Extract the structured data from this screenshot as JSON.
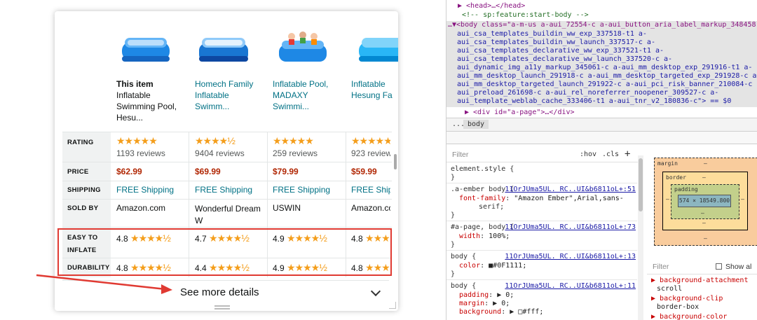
{
  "products": [
    {
      "title_lines": [
        "This item",
        "Inflatable",
        "Swimming Pool,",
        "Hesu..."
      ],
      "is_this_item": true,
      "rating_stars": "★★★★★",
      "reviews": "1193 reviews",
      "price": "$62.99",
      "shipping": "FREE Shipping",
      "sold_by": "Amazon.com",
      "easy_inflate_score": "4.8",
      "easy_inflate_stars": "★★★★½",
      "durability_score": "4.8",
      "durability_stars": "★★★★½"
    },
    {
      "title_lines": [
        "Homech Family",
        "Inflatable",
        "Swimm..."
      ],
      "is_this_item": false,
      "rating_stars": "★★★★½",
      "reviews": "9404 reviews",
      "price": "$69.99",
      "shipping": "FREE Shipping",
      "sold_by": "Wonderful Dream W",
      "easy_inflate_score": "4.7",
      "easy_inflate_stars": "★★★★½",
      "durability_score": "4.4",
      "durability_stars": "★★★★½"
    },
    {
      "title_lines": [
        "Inflatable Pool,",
        "MADAXY",
        "Swimmi..."
      ],
      "is_this_item": false,
      "rating_stars": "★★★★★",
      "reviews": "259 reviews",
      "price": "$79.99",
      "shipping": "FREE Shipping",
      "sold_by": "USWIN",
      "easy_inflate_score": "4.9",
      "easy_inflate_stars": "★★★★½",
      "durability_score": "4.9",
      "durability_stars": "★★★★½"
    },
    {
      "title_lines": [
        "Inflatable",
        "Hesung Fa"
      ],
      "is_this_item": false,
      "rating_stars": "★★★★★",
      "reviews": "923 review",
      "price": "$59.99",
      "shipping": "FREE Shipp",
      "sold_by": "Amazon.com",
      "easy_inflate_score": "4.8",
      "easy_inflate_stars": "★★★",
      "durability_score": "4.8",
      "durability_stars": "★★★"
    }
  ],
  "row_labels": {
    "rating": "RATING",
    "price": "PRICE",
    "shipping": "SHIPPING",
    "sold_by": "SOLD BY",
    "easy_to": "EASY TO",
    "inflate": "INFLATE",
    "durability": "DURABILITY"
  },
  "see_more": "See more details",
  "devtools": {
    "dom_lines": [
      "▶ <head>…</head>",
      "<!-- sp:feature:start-body -->",
      "…▼<body class=\"a-m-us a-aui_72554-c a-aui_button_aria_label_markup_348458-c a-",
      "aui_csa_templates_buildin_ww_exp_337518-t1 a-",
      "aui_csa_templates_buildin_ww_launch_337517-c a-",
      "aui_csa_templates_declarative_ww_exp_337521-t1 a-",
      "aui_csa_templates_declarative_ww_launch_337520-c a-",
      "aui_dynamic_img_a11y_markup_345061-c a-aui_mm_desktop_exp_291916-t1 a-",
      "aui_mm_desktop_launch_291918-c a-aui_mm_desktop_targeted_exp_291928-c a-",
      "aui_mm_desktop_targeted_launch_291922-c a-aui_pci_risk_banner_210084-c a-",
      "aui_preload_261698-c a-aui_rel_noreferrer_noopener_309527-c a-",
      "aui_template_weblab_cache_333406-t1 a-aui_tnr_v2_180836-c\"> == $0",
      "▶ <div id=\"a-page\">…</div>"
    ],
    "crumb_dots": "...",
    "crumb_body": "body",
    "filter_placeholder": "Filter",
    "hov": ":hov",
    "cls": ".cls",
    "plus": "+",
    "styles": [
      {
        "selector": "element.style {",
        "source": "",
        "decls": [],
        "close": "}"
      },
      {
        "selector": ".a-ember body {",
        "source": "11OrJUma5UL. RC..UI&b6811oL+:51",
        "decls": [
          [
            "font-family",
            "\"Amazon Ember\",Arial,sans-"
          ],
          [
            "",
            "serif;"
          ]
        ],
        "close": "}"
      },
      {
        "selector": "#a-page, body {",
        "source": "11OrJUma5UL. RC..UI&b6811oL+:73",
        "decls": [
          [
            "width",
            "100%;"
          ]
        ],
        "close": "}"
      },
      {
        "selector": "body {",
        "source": "11OrJUma5UL. RC..UI&b6811oL+:13",
        "decls": [
          [
            "color",
            "■#0F1111;"
          ]
        ],
        "close": "}"
      },
      {
        "selector": "body {",
        "source": "11OrJUma5UL. RC..UI&b6811oL+:11",
        "decls": [
          [
            "padding",
            "▶ 0;"
          ],
          [
            "margin",
            "▶ 0;"
          ],
          [
            "background",
            "▶ □#fff;"
          ]
        ],
        "close": ""
      }
    ],
    "boxmodel": {
      "margin": "margin",
      "border": "border",
      "padding": "padding",
      "dash": "–",
      "content": "574 × 18549.800"
    },
    "computed_filter": "Filter",
    "show_all": "Show al",
    "computed": [
      {
        "prop": "background-attachment",
        "val": "scroll"
      },
      {
        "prop": "background-clip",
        "val": "border-box"
      },
      {
        "prop": "background-color",
        "val": ""
      }
    ]
  },
  "colors": {
    "price": "#b12704",
    "link": "#007185",
    "stars": "#f49e1c",
    "highlight": "#e03a32"
  }
}
